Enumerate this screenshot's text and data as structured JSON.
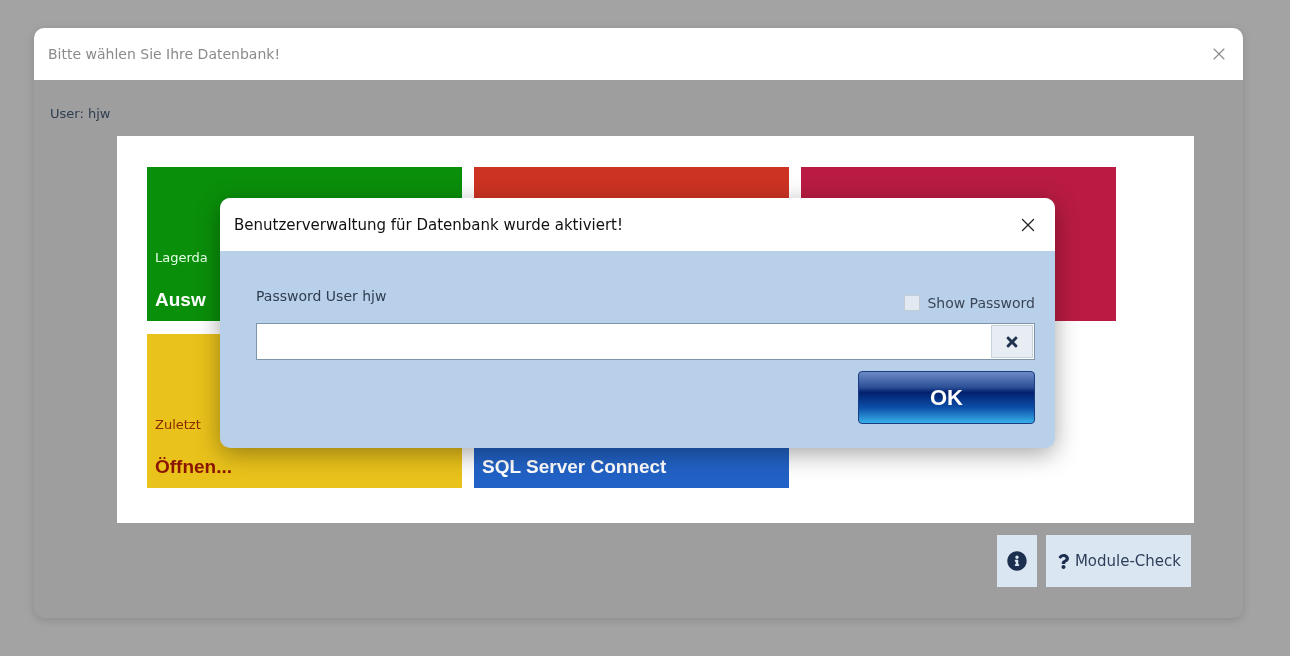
{
  "window": {
    "title": "Bitte wählen Sie Ihre Datenbank!"
  },
  "user_label": "User: hjw",
  "tiles": [
    {
      "color": "#0a8f0a",
      "caption": "Lagerda",
      "action": "Ausw"
    },
    {
      "color": "#cc3323"
    },
    {
      "color": "#b91b42"
    },
    {
      "color": "#e9c21b",
      "caption": "Zuletzt",
      "action": "Öffnen..."
    },
    {
      "color": "#2262c6",
      "action": "SQL Server Connect"
    }
  ],
  "dialog": {
    "title": "Benutzerverwaltung für Datenbank wurde aktiviert!",
    "label": "Password User hjw",
    "show_password": {
      "label": "Show Password",
      "checked": false
    },
    "ok": "OK"
  },
  "module_check": "Module-Check"
}
